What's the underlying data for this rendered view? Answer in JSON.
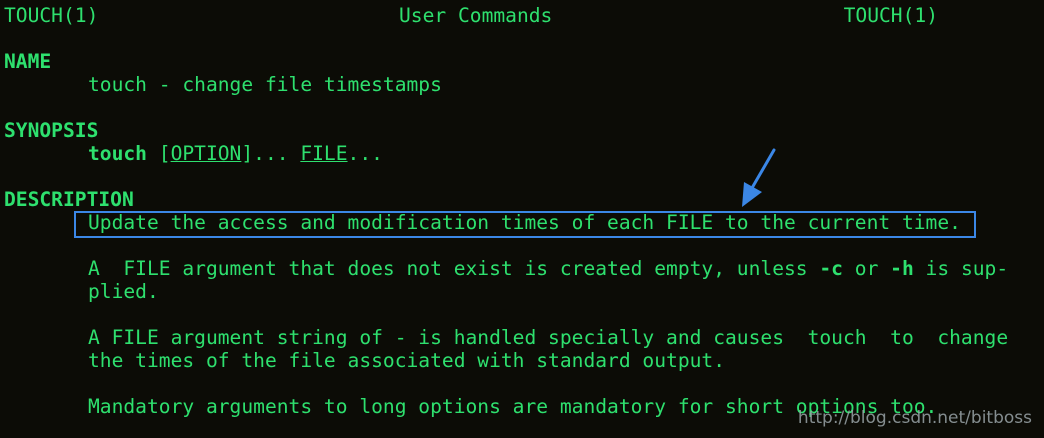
{
  "header": {
    "left": "TOUCH(1)",
    "center": "User Commands",
    "right": "TOUCH(1)"
  },
  "name_section": {
    "heading": "NAME",
    "text": "touch - change file timestamps"
  },
  "synopsis_section": {
    "heading": "SYNOPSIS",
    "command": "touch",
    "sep1": " [",
    "option": "OPTION",
    "sep2": "]... ",
    "file": "FILE",
    "sep3": "..."
  },
  "description_section": {
    "heading": "DESCRIPTION",
    "para1": "Update the access and modification times of each FILE to the current time.",
    "para2_line1_a": "A  FILE argument that does not exist is created empty, unless ",
    "para2_flag_c": "-c",
    "para2_line1_b": " or ",
    "para2_flag_h": "-h",
    "para2_line1_c": " is sup-",
    "para2_line2": "plied.",
    "para3_line1": "A FILE argument string of - is handled specially and causes  touch  to  change",
    "para3_line2": "the times of the file associated with standard output.",
    "para4": "Mandatory arguments to long options are mandatory for short options too."
  },
  "annotation": {
    "box_color": "#3b87e6",
    "arrow_color": "#3b87e6"
  },
  "watermark": "http://blog.csdn.net/bitboss"
}
